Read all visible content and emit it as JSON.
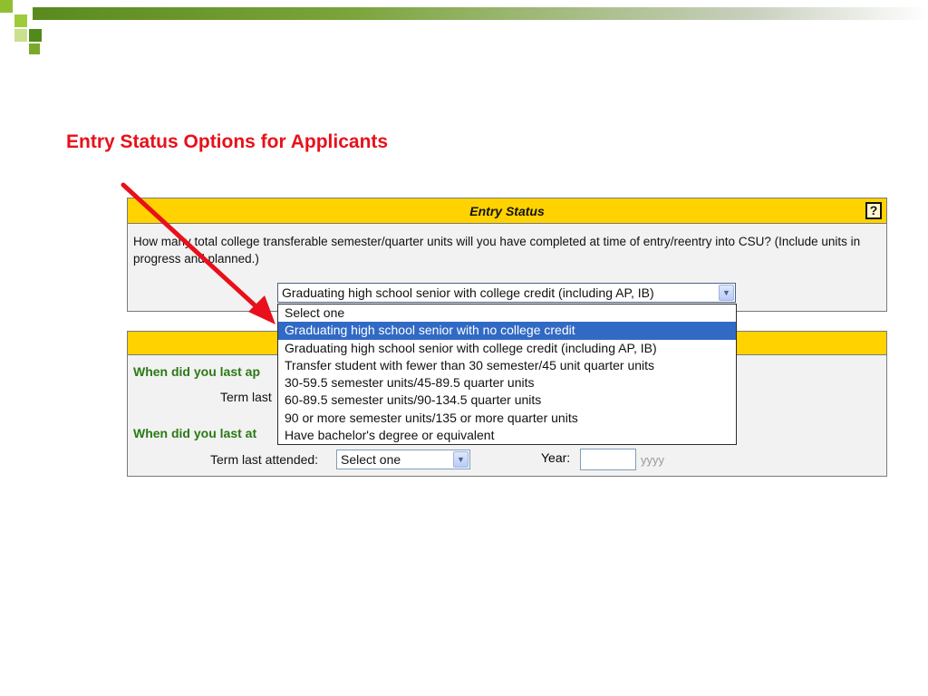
{
  "slide": {
    "title": "Entry Status Options for Applicants"
  },
  "entry_status": {
    "header": "Entry Status",
    "help": "?",
    "question": "How many total college transferable semester/quarter units will you have completed at time of entry/reentry into CSU? (Include units in progress and planned.)",
    "selected_value": "Graduating high school senior with college credit (including AP, IB)",
    "options": [
      "Select one",
      "Graduating high school senior with no college credit",
      "Graduating high school senior with college credit (including AP, IB)",
      "Transfer student with fewer than 30 semester/45 unit quarter units",
      "30-59.5 semester units/45-89.5 quarter units",
      "60-89.5 semester units/90-134.5 quarter units",
      "90 or more semester units/135 or more quarter units",
      "Have bachelor's degree or equivalent"
    ],
    "highlighted_option": "Graduating high school senior with no college credit"
  },
  "attendance": {
    "question1_partial": "When did you last ap",
    "term_label1_partial": "Term last",
    "question2_partial": "When did you last at",
    "term_label2": "Term last attended:",
    "term_select_value": "Select one",
    "year_label": "Year:",
    "year_value": "",
    "year_hint": "yyyy"
  },
  "colors": {
    "title_red": "#e8101a",
    "header_yellow": "#ffd200",
    "green_label": "#2a7a14",
    "highlight_blue": "#316ac5",
    "arrow_red": "#e8101a"
  }
}
